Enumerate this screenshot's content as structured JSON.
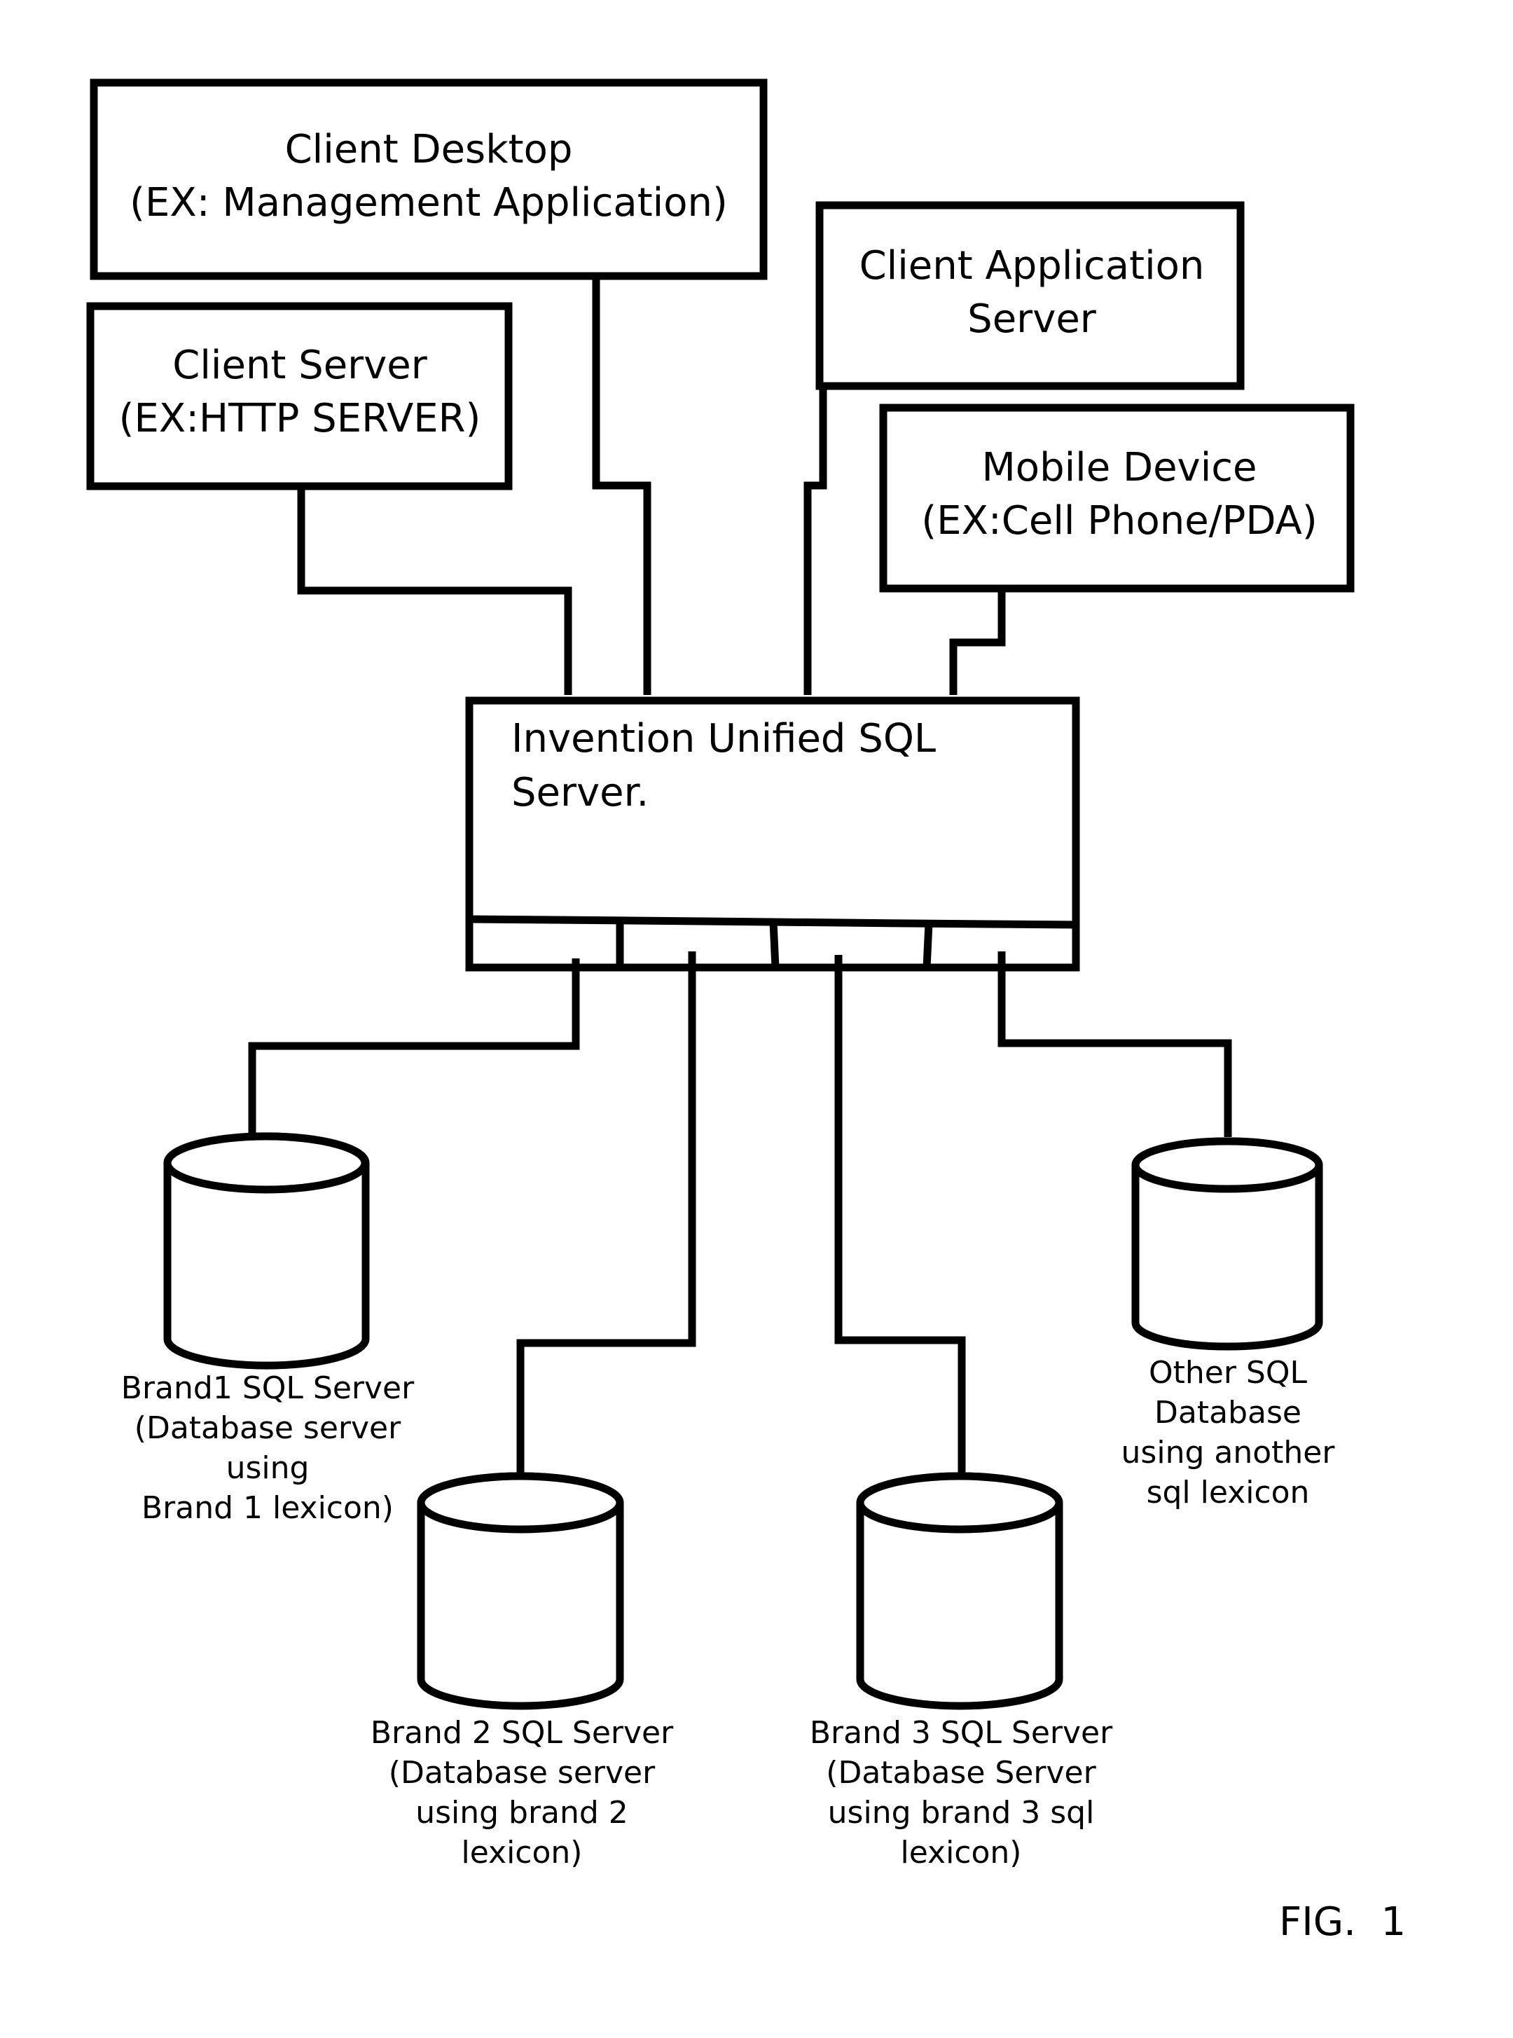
{
  "figure": {
    "label": "FIG.  1",
    "clients": [
      {
        "id": "client-desktop",
        "lines": [
          "Client Desktop",
          "(EX: Management Application)"
        ]
      },
      {
        "id": "client-server",
        "lines": [
          "Client Server",
          "(EX:HTTP SERVER)"
        ]
      },
      {
        "id": "client-application-server",
        "lines": [
          "Client Application",
          "Server"
        ]
      },
      {
        "id": "mobile-device",
        "lines": [
          "Mobile Device",
          "(EX:Cell Phone/PDA)"
        ]
      }
    ],
    "hub": {
      "id": "unified-sql-server",
      "lines": [
        "Invention Unified SQL",
        "Server."
      ],
      "port_count": 4
    },
    "databases": [
      {
        "id": "brand1-sql-server",
        "lines": [
          "Brand1 SQL Server",
          "(Database server",
          "using",
          "Brand 1 lexicon)"
        ]
      },
      {
        "id": "brand2-sql-server",
        "lines": [
          "Brand 2  SQL Server",
          "(Database server",
          "using brand 2",
          "lexicon)"
        ]
      },
      {
        "id": "brand3-sql-server",
        "lines": [
          "Brand 3 SQL Server",
          "(Database Server",
          "using brand 3 sql",
          "lexicon)"
        ]
      },
      {
        "id": "other-sql-database",
        "lines": [
          "Other SQL",
          "Database",
          "using another",
          "sql lexicon"
        ]
      }
    ],
    "connections": [
      {
        "from": "client-server",
        "to": "unified-sql-server"
      },
      {
        "from": "client-desktop",
        "to": "unified-sql-server"
      },
      {
        "from": "client-application-server",
        "to": "unified-sql-server"
      },
      {
        "from": "mobile-device",
        "to": "unified-sql-server"
      },
      {
        "from": "unified-sql-server",
        "to": "brand1-sql-server",
        "port": 1
      },
      {
        "from": "unified-sql-server",
        "to": "brand2-sql-server",
        "port": 2
      },
      {
        "from": "unified-sql-server",
        "to": "brand3-sql-server",
        "port": 3
      },
      {
        "from": "unified-sql-server",
        "to": "other-sql-database",
        "port": 4
      }
    ]
  }
}
